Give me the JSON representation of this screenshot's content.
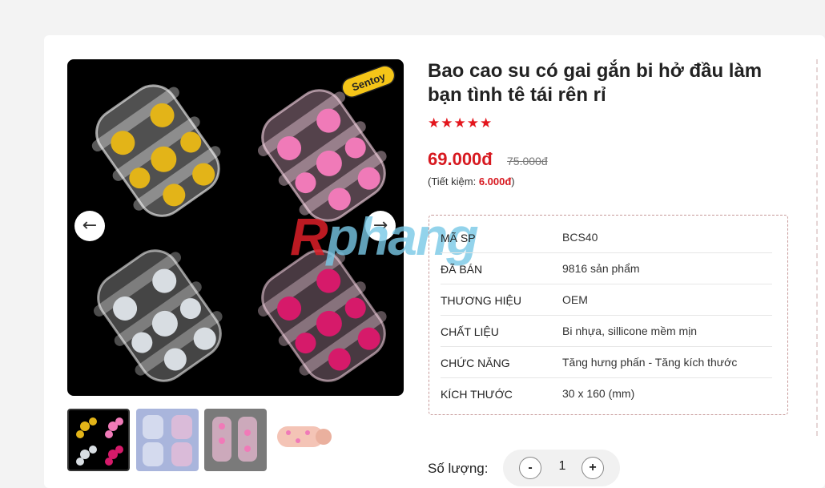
{
  "product": {
    "title": "Bao cao su có gai gắn bi hở đầu làm bạn tình tê tái rên rỉ",
    "rating_stars": "★★★★★",
    "price": "69.000đ",
    "old_price": "75.000đ",
    "savings_prefix": "(Tiết kiệm: ",
    "savings_amount": "6.000đ",
    "savings_suffix": ")"
  },
  "gallery": {
    "brand_badge": "Sentoy",
    "prev_icon": "arrow-left-icon",
    "next_icon": "arrow-right-icon"
  },
  "watermark": {
    "part1": "R",
    "part2": "phang"
  },
  "specs": [
    {
      "key": "Mã SP",
      "value": "BCS40"
    },
    {
      "key": "Đã bán",
      "value": "9816 sản phẩm"
    },
    {
      "key": "Thương hiệu",
      "value": "OEM"
    },
    {
      "key": "Chất liệu",
      "value": "Bi nhựa, sillicone mềm mịn"
    },
    {
      "key": "Chức năng",
      "value": "Tăng hưng phấn - Tăng kích thước"
    },
    {
      "key": "Kích thước",
      "value": "30 x 160 (mm)"
    }
  ],
  "quantity": {
    "label": "Số lượng:",
    "minus": "-",
    "value": "1",
    "plus": "+"
  },
  "colors": {
    "accent": "#d71920",
    "gold_bead": "#e3b418",
    "pink_bead": "#f07ab8",
    "white_bead": "#d8dde2",
    "magenta_bead": "#d61a6a"
  }
}
